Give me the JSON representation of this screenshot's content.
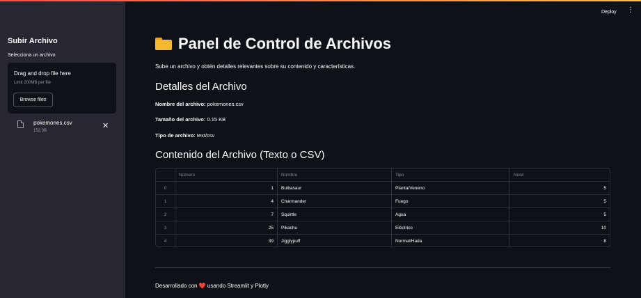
{
  "app": {
    "deploy_label": "Deploy",
    "menu_icon": "kebab-menu-icon",
    "accent_gradient": [
      "#ff4b4b",
      "#ffbd45"
    ]
  },
  "sidebar": {
    "title": "Subir Archivo",
    "uploader_label": "Selecciona un archivo",
    "dropzone_title": "Drag and drop file here",
    "dropzone_limit": "Limit 200MB per file",
    "browse_label": "Browse files",
    "uploaded_file": {
      "name": "pokemones.csv",
      "size": "152.0B",
      "icon": "file-icon",
      "remove_icon": "close-icon"
    }
  },
  "main": {
    "title": "Panel de Control de Archivos",
    "title_icon": "folder-icon",
    "description": "Sube un archivo y obtén detalles relevantes sobre su contenido y características.",
    "details_heading": "Detalles del Archivo",
    "details": [
      {
        "label": "Nombre del archivo:",
        "value": " pokemones.csv"
      },
      {
        "label": "Tamaño del archivo:",
        "value": " 0.15 KB"
      },
      {
        "label": "Tipo de archivo:",
        "value": " text/csv"
      }
    ],
    "content_heading": "Contenido del Archivo (Texto o CSV)",
    "table": {
      "columns": [
        "",
        "Número",
        "Nombre",
        "Tipo",
        "Nivel"
      ],
      "rows": [
        [
          "0",
          "1",
          "Bulbasaur",
          "Planta/Veneno",
          "5"
        ],
        [
          "1",
          "4",
          "Charmander",
          "Fuego",
          "5"
        ],
        [
          "2",
          "7",
          "Squirtle",
          "Agua",
          "5"
        ],
        [
          "3",
          "25",
          "Pikachu",
          "Eléctrico",
          "10"
        ],
        [
          "4",
          "39",
          "Jigglypuff",
          "Normal/Hada",
          "8"
        ]
      ]
    },
    "footer_before": "Desarrollado con ",
    "footer_heart": "❤️",
    "footer_after": " usando Streamlit y Plotly"
  }
}
